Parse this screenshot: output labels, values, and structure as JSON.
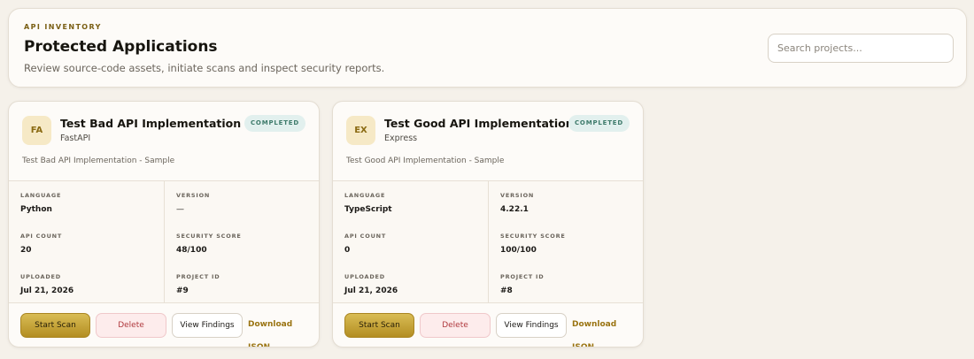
{
  "header": {
    "eyebrow": "API INVENTORY",
    "title": "Protected Applications",
    "subtitle": "Review source-code assets, initiate scans and inspect security reports."
  },
  "search": {
    "placeholder": "Search projects...",
    "value": ""
  },
  "field_labels": {
    "language": "LANGUAGE",
    "version": "VERSION",
    "api_count": "API COUNT",
    "security_score": "SECURITY SCORE",
    "uploaded": "UPLOADED",
    "project_id": "PROJECT ID"
  },
  "actions": {
    "start_scan": "Start Scan",
    "delete": "Delete",
    "view_findings": "View Findings",
    "download_json": "Download JSON"
  },
  "projects": [
    {
      "initials": "FA",
      "name": "Test Bad API Implementation",
      "framework": "FastAPI",
      "status": "COMPLETED",
      "description": "Test Bad API Implementation - Sample",
      "language": "Python",
      "version": "—",
      "api_count": "20",
      "security_score": "48/100",
      "uploaded": "Jul 21, 2026",
      "project_id": "#9"
    },
    {
      "initials": "EX",
      "name": "Test Good API Implementation",
      "framework": "Express",
      "status": "COMPLETED",
      "description": "Test Good API Implementation - Sample",
      "language": "TypeScript",
      "version": "4.22.1",
      "api_count": "0",
      "security_score": "100/100",
      "uploaded": "Jul 21, 2026",
      "project_id": "#8"
    }
  ]
}
